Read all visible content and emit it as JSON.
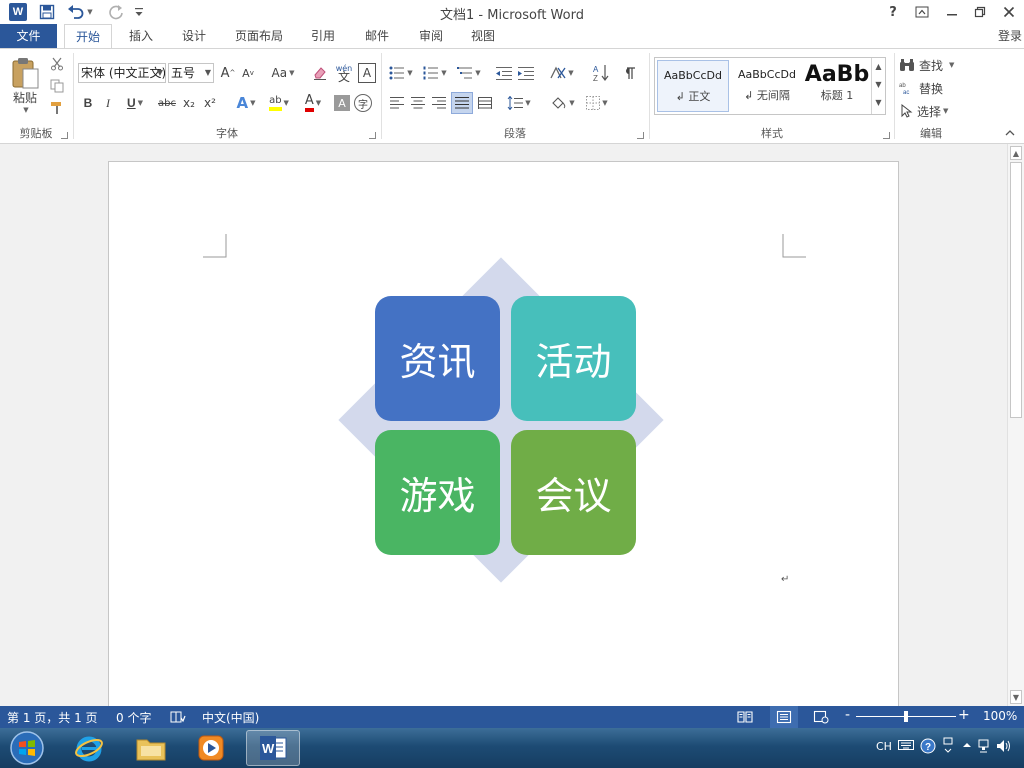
{
  "window": {
    "title": "文档1 - Microsoft Word",
    "help_label": "?",
    "app_icon_label": "W"
  },
  "tabs": {
    "file": "文件",
    "items": [
      "开始",
      "插入",
      "设计",
      "页面布局",
      "引用",
      "邮件",
      "审阅",
      "视图"
    ],
    "active_index": 0,
    "login": "登录"
  },
  "ribbon": {
    "clipboard": {
      "paste_label": "粘贴",
      "group_label": "剪贴板"
    },
    "font": {
      "font_name": "宋体 (中文正文)",
      "font_size": "五号",
      "grow_label": "A",
      "shrink_label": "A",
      "case_label": "Aa",
      "phonetic_label": "wén",
      "phonetic_char": "文",
      "border_char_label": "A",
      "bold": "B",
      "italic": "I",
      "underline": "U",
      "strike": "abc",
      "subscript": "x₂",
      "superscript": "x²",
      "effects": "A",
      "highlight": "ab",
      "font_color": "A",
      "shading": "A",
      "enclose": "字",
      "group_label": "字体"
    },
    "paragraph": {
      "group_label": "段落"
    },
    "styles": {
      "items": [
        {
          "sample": "AaBbCcDd",
          "name": "↲ 正文"
        },
        {
          "sample": "AaBbCcDd",
          "name": "↲ 无间隔"
        },
        {
          "sample": "AaBb",
          "name": "标题 1"
        }
      ],
      "group_label": "样式"
    },
    "editing": {
      "find": "查找",
      "replace": "替换",
      "select": "选择",
      "group_label": "编辑"
    }
  },
  "document": {
    "smartart": {
      "cells": [
        {
          "text": "资讯",
          "color": "#4472c4"
        },
        {
          "text": "活动",
          "color": "#47bfbb"
        },
        {
          "text": "游戏",
          "color": "#4ab563"
        },
        {
          "text": "会议",
          "color": "#70ad47"
        }
      ],
      "diamond_color": "#d3d9ec"
    },
    "paragraph_mark": "↵"
  },
  "statusbar": {
    "page": "第 1 页，共 1 页",
    "words": "0 个字",
    "language": "中文(中国)",
    "zoom_minus": "-",
    "zoom_plus": "+",
    "zoom_percent": "100%",
    "zoom_level": 0.5
  },
  "taskbar": {
    "tray_lang": "CH"
  },
  "colors": {
    "word_blue": "#2b579a"
  }
}
